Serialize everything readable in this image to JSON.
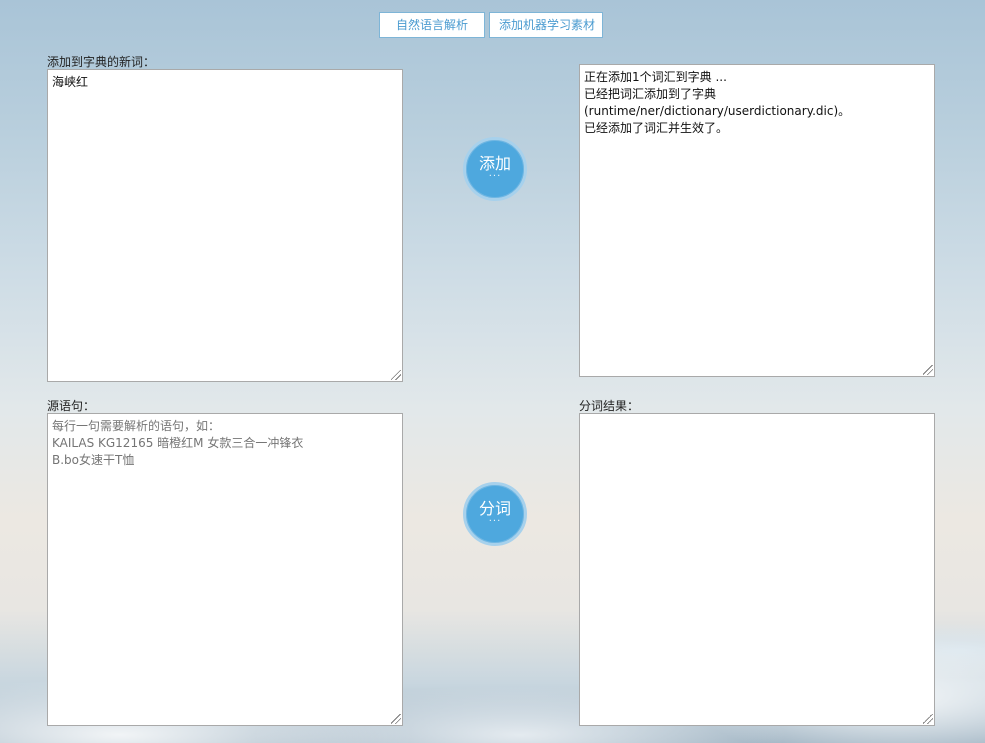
{
  "toolbar": {
    "nlp_button": "自然语言解析",
    "ml_button": "添加机器学习素材"
  },
  "dictionary": {
    "label": "添加到字典的新词：",
    "input_value": "海峡红",
    "add_button": "添加",
    "add_button_dots": "···",
    "output_lines": [
      "正在添加1个词汇到字典 ...",
      "已经把词汇添加到了字典",
      "(runtime/ner/dictionary/userdictionary.dic)。",
      "已经添加了词汇并生效了。"
    ]
  },
  "segment": {
    "label": "源语句：",
    "placeholder_lines": [
      "每行一句需要解析的语句，如：",
      "KAILAS KG12165 暗橙红M 女款三合一冲锋衣",
      "B.bo女速干T恤"
    ],
    "button": "分词",
    "button_dots": "···",
    "result_label": "分词结果："
  }
}
